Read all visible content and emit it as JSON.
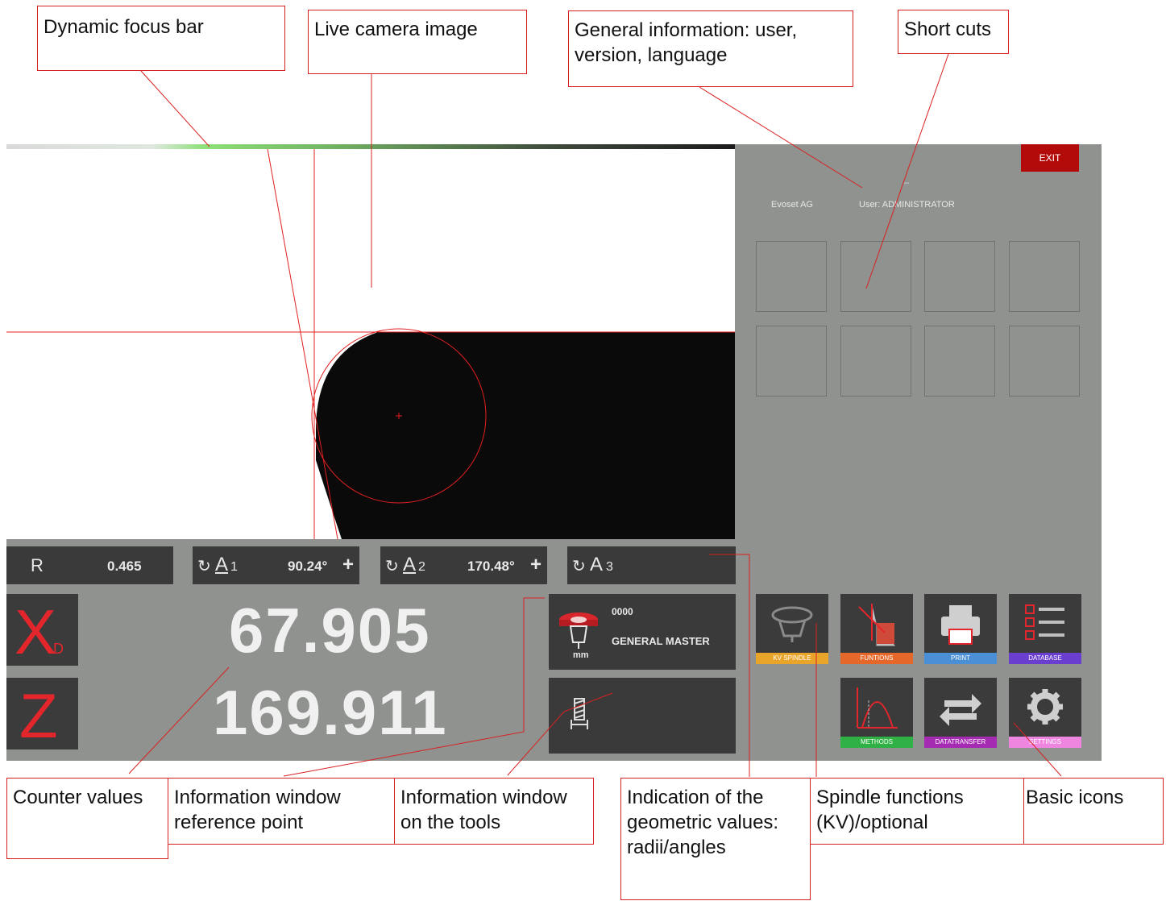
{
  "annotations": {
    "focus_bar": "Dynamic focus bar",
    "camera": "Live camera image",
    "general_info": "General information: user,\nversion, language",
    "shortcuts": "Short cuts",
    "counter_values": "Counter values",
    "info_reference": "Information window\nreference point",
    "info_tools": "Information window\non the tools",
    "geometric": "Indication of the\ngeometric values:\nradii/angles",
    "spindle": "Spindle functions\n(KV)/optional",
    "basic_icons": "Basic icons"
  },
  "header": {
    "exit_label": "EXIT",
    "dash": "–",
    "company": "Evoset AG",
    "user": "User: ADMINISTRATOR"
  },
  "geometry_bar": {
    "r_label": "R",
    "r_value": "0.465",
    "a1_label": "A",
    "a1_index": "1",
    "a1_value": "90.24°",
    "a2_label": "A",
    "a2_index": "2",
    "a2_value": "170.48°",
    "a3_label": "A",
    "a3_index": "3"
  },
  "counters": {
    "x_axis": "X",
    "x_sub": "D",
    "x_value": "67.905",
    "z_axis": "Z",
    "z_value": "169.911"
  },
  "reference_info": {
    "code": "0000",
    "name": "GENERAL MASTER",
    "unit": "mm"
  },
  "buttons": {
    "kv_spindle": "KV SPINDLE",
    "functions": "FUNTIONS",
    "print": "PRINT",
    "database": "DATABASE",
    "methods": "METHODS",
    "datatransfer": "DATATRANSFER",
    "settings": "SETTINGS"
  },
  "colors": {
    "exit_red": "#b30a0a",
    "kv_spindle": "#e9a42a",
    "functions": "#e5672a",
    "print": "#4b8fd6",
    "database": "#6a3fd0",
    "methods": "#2fb145",
    "datatransfer": "#a52bb3",
    "settings": "#ee86e0",
    "counter_red": "#e3262c"
  }
}
